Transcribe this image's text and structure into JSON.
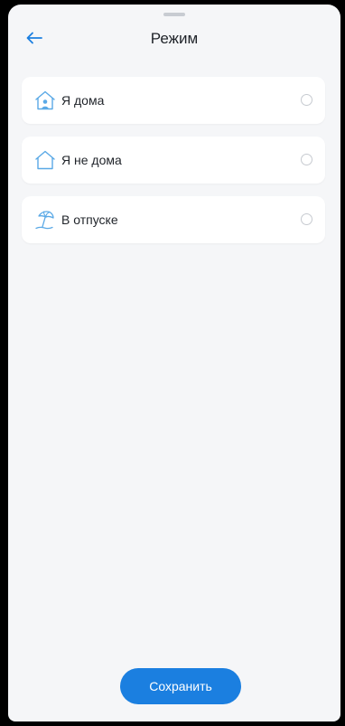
{
  "header": {
    "title": "Режим",
    "back_icon": "arrow-left-icon"
  },
  "modes": [
    {
      "label": "Я дома",
      "icon": "home-person-icon",
      "selected": false
    },
    {
      "label": "Я не дома",
      "icon": "home-outline-icon",
      "selected": false
    },
    {
      "label": "В отпуске",
      "icon": "beach-umbrella-icon",
      "selected": false
    }
  ],
  "footer": {
    "save_label": "Сохранить"
  },
  "colors": {
    "accent": "#1b7fe0",
    "icon_tint": "#5aa9e6",
    "background": "#f5f6f8",
    "card": "#ffffff",
    "text": "#1f2329"
  }
}
